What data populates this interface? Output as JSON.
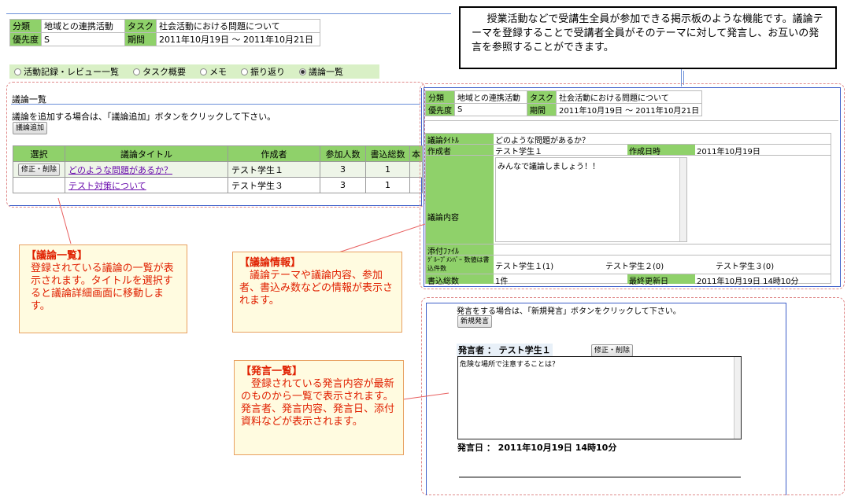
{
  "header": {
    "category_label": "分類",
    "category_value": "地域との連携活動",
    "task_label": "タスク",
    "task_value": "社会活動における問題について",
    "priority_label": "優先度",
    "priority_value": "S",
    "period_label": "期間",
    "period_value": "2011年10月19日 ～ 2011年10月21日"
  },
  "radios": [
    {
      "label": "活動記録・レビュー一覧",
      "checked": false
    },
    {
      "label": "タスク概要",
      "checked": false
    },
    {
      "label": "メモ",
      "checked": false
    },
    {
      "label": "振り返り",
      "checked": false
    },
    {
      "label": "議論一覧",
      "checked": true
    }
  ],
  "list_panel": {
    "title": "議論一覧",
    "instruction": "議論を追加する場合は、「議論追加」ボタンをクリックして下さい。",
    "add_button": "議論追加",
    "columns": [
      "選択",
      "議論タイトル",
      "作成者",
      "参加人数",
      "書込総数",
      "本"
    ],
    "rows": [
      {
        "action": "修正・削除",
        "title": "どのような問題があるか？",
        "author": "テスト学生１",
        "participants": "3",
        "posts": "1"
      },
      {
        "action": "",
        "title": "テスト対策について",
        "author": "テスト学生３",
        "participants": "3",
        "posts": "1"
      }
    ]
  },
  "top_note": "授業活動などで受講生全員が参加できる掲示板のような機能です。議論テーマを登録することで受講者全員がそのテーマに対して発言し、お互いの発言を参照することができます。",
  "detail": {
    "title_label": "議論ﾀｲﾄﾙ",
    "title_value": "どのような問題があるか？",
    "author_label": "作成者",
    "author_value": "テスト学生１",
    "created_label": "作成日時",
    "created_value": "2011年10月19日",
    "content_label": "議論内容",
    "content_value": "みんなで議論しましょう！！",
    "attach_label": "添付ﾌｧｲﾙ",
    "members_label": "ｸﾞﾙｰﾌﾟﾒﾝﾊﾞｰ 数値は書込件数",
    "members": [
      "テスト学生１(1)",
      "テスト学生２(0)",
      "テスト学生３(0)"
    ],
    "posts_label": "書込総数",
    "posts_value": "1件",
    "updated_label": "最終更新日",
    "updated_value": "2011年10月19日 14時10分"
  },
  "post_panel": {
    "instruction": "発言をする場合は、「新規発言」ボタンをクリックして下さい。",
    "new_button": "新規発言",
    "speaker_label": "発言者 ： テスト学生１",
    "edit_button": "修正・削除",
    "content": "危険な場所で注意することは？",
    "date_label": "発言日 ： 2011年10月19日 14時10分"
  },
  "callouts": {
    "list": {
      "title": "【議論一覧】",
      "body": "登録されている議論の一覧が表示されます。タイトルを選択すると議論詳細画面に移動します。"
    },
    "info": {
      "title": "【議論情報】",
      "body": "議論テーマや議論内容、参加者、書込み数などの情報が表示されます。"
    },
    "posts": {
      "title": "【発言一覧】",
      "body": "登録されている発言内容が最新のものから一覧で表示されます。発言者、発言内容、発言日、添付資料などが表示されます。"
    }
  },
  "colors": {
    "header_green": "#8fd16a",
    "light_green": "#d9f0c6",
    "callout_text": "#e02000",
    "callout_bg": "#fffbe0"
  }
}
